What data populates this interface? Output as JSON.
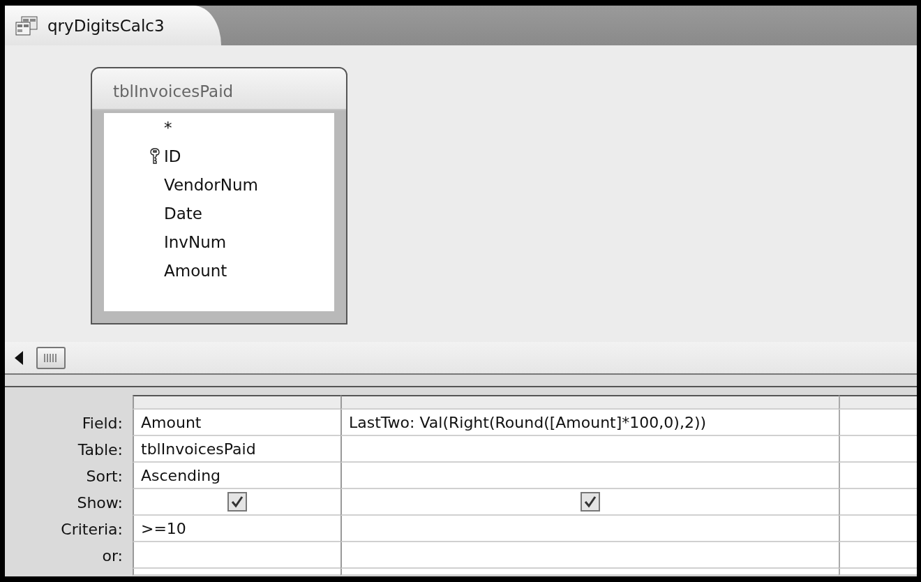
{
  "tab": {
    "title": "qryDigitsCalc3"
  },
  "table_box": {
    "title": "tblInvoicesPaid",
    "fields": [
      {
        "name": "*",
        "primary_key": false
      },
      {
        "name": "ID",
        "primary_key": true
      },
      {
        "name": "VendorNum",
        "primary_key": false
      },
      {
        "name": "Date",
        "primary_key": false
      },
      {
        "name": "InvNum",
        "primary_key": false
      },
      {
        "name": "Amount",
        "primary_key": false
      }
    ]
  },
  "grid": {
    "row_labels": [
      "Field:",
      "Table:",
      "Sort:",
      "Show:",
      "Criteria:",
      "or:"
    ],
    "columns": [
      {
        "field": "Amount",
        "table": "tblInvoicesPaid",
        "sort": "Ascending",
        "show": true,
        "criteria": ">=10"
      },
      {
        "field": "LastTwo: Val(Right(Round([Amount]*100,0),2))",
        "show": true
      }
    ]
  }
}
